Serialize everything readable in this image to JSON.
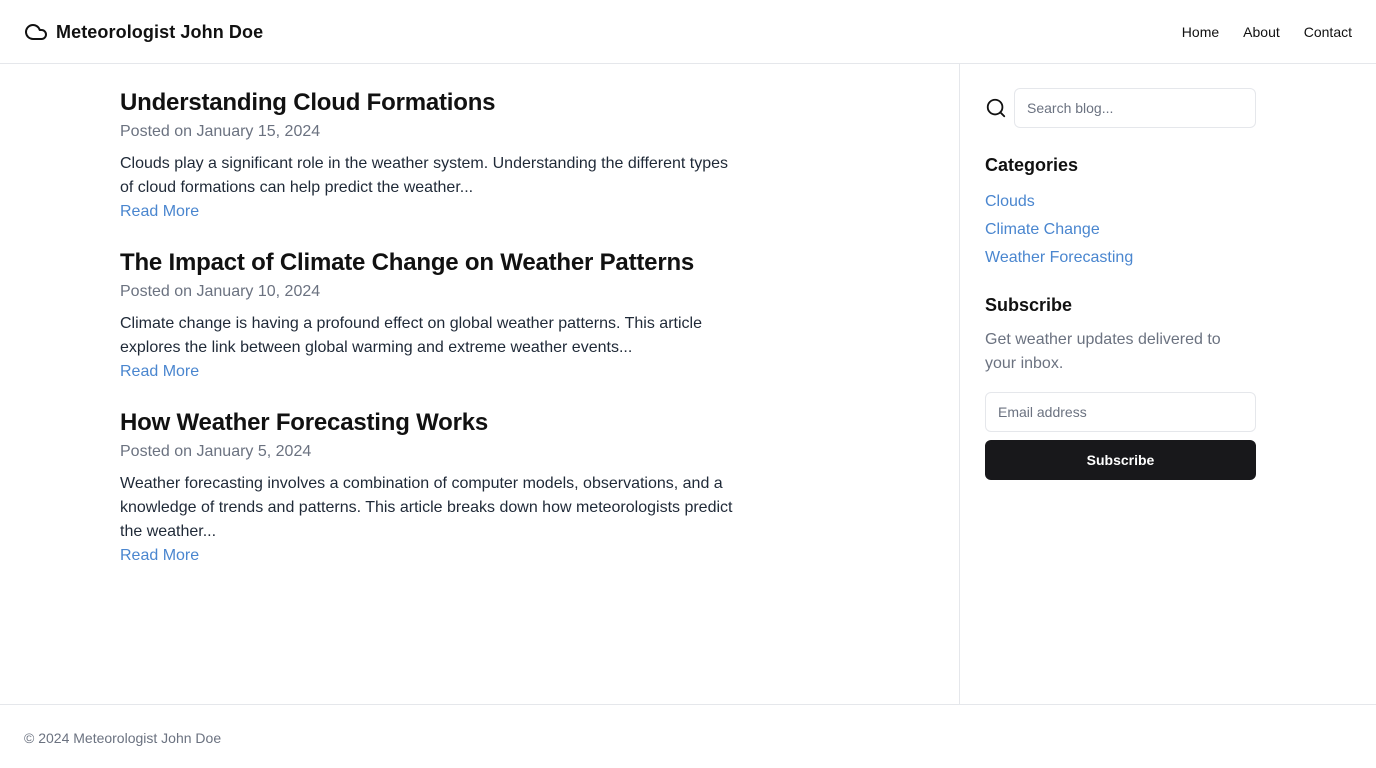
{
  "header": {
    "brand_icon": "cloud-icon",
    "title": "Meteorologist John Doe",
    "nav": [
      {
        "label": "Home"
      },
      {
        "label": "About"
      },
      {
        "label": "Contact"
      }
    ]
  },
  "posts": [
    {
      "title": "Understanding Cloud Formations",
      "date": "Posted on January 15, 2024",
      "excerpt": "Clouds play a significant role in the weather system. Understanding the different types of cloud formations can help predict the weather...",
      "read_more": "Read More"
    },
    {
      "title": "The Impact of Climate Change on Weather Patterns",
      "date": "Posted on January 10, 2024",
      "excerpt": "Climate change is having a profound effect on global weather patterns. This article explores the link between global warming and extreme weather events...",
      "read_more": "Read More"
    },
    {
      "title": "How Weather Forecasting Works",
      "date": "Posted on January 5, 2024",
      "excerpt": "Weather forecasting involves a combination of computer models, observations, and a knowledge of trends and patterns. This article breaks down how meteorologists predict the weather...",
      "read_more": "Read More"
    }
  ],
  "sidebar": {
    "search": {
      "icon": "search-icon",
      "placeholder": "Search blog..."
    },
    "categories": {
      "heading": "Categories",
      "items": [
        {
          "label": "Clouds"
        },
        {
          "label": "Climate Change"
        },
        {
          "label": "Weather Forecasting"
        }
      ]
    },
    "subscribe": {
      "heading": "Subscribe",
      "text": "Get weather updates delivered to your inbox.",
      "email_placeholder": "Email address",
      "button_label": "Subscribe"
    }
  },
  "footer": {
    "text": "© 2024 Meteorologist John Doe"
  },
  "colors": {
    "link": "#4a86cf",
    "button_bg": "#18181b",
    "muted_text": "#6b7280",
    "border": "#e5e7eb"
  }
}
